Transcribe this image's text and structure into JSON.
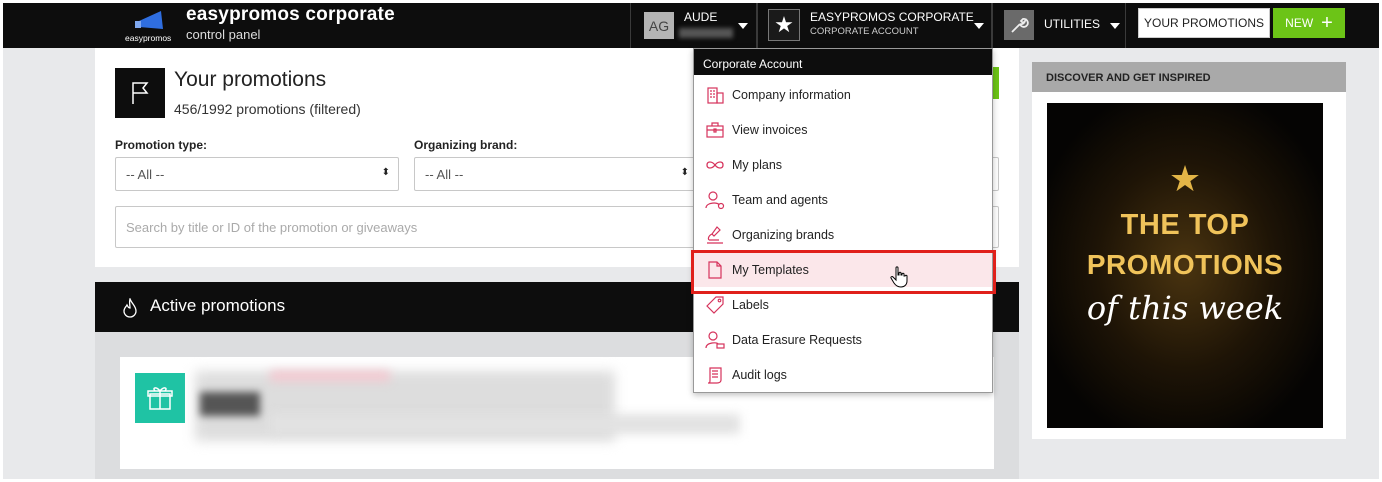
{
  "brand": {
    "name": "easypromos corporate",
    "subtitle": "control panel",
    "logo_text": "easypromos"
  },
  "topbar": {
    "user_initials": "AG",
    "user_name": "AUDE",
    "account_name": "EASYPROMOS CORPORATE",
    "account_type": "CORPORATE ACCOUNT",
    "utilities_label": "UTILITIES",
    "your_promotions_label": "YOUR PROMOTIONS",
    "new_label": "NEW",
    "new_plus": "+"
  },
  "panel": {
    "title": "Your promotions",
    "count": "456/1992 promotions (filtered)",
    "promotion_type_label": "Promotion type:",
    "promotion_type_value": "-- All --",
    "organizing_brand_label": "Organizing brand:",
    "organizing_brand_value": "-- All --",
    "select_arrow": "⬍",
    "search_placeholder": "Search by title or ID of the promotion or giveaways"
  },
  "active": {
    "label": "Active promotions"
  },
  "sidebar": {
    "heading": "DISCOVER AND GET INSPIRED",
    "banner_star": "★",
    "banner_line1": "THE TOP",
    "banner_line2": "PROMOTIONS",
    "banner_line3": "of this week"
  },
  "dropdown": {
    "heading": "Corporate Account",
    "items": [
      {
        "label": "Company information",
        "icon": "building-icon"
      },
      {
        "label": "View invoices",
        "icon": "briefcase-icon"
      },
      {
        "label": "My plans",
        "icon": "infinity-icon"
      },
      {
        "label": "Team and agents",
        "icon": "user-gear-icon"
      },
      {
        "label": "Organizing brands",
        "icon": "stamp-icon"
      },
      {
        "label": "My Templates",
        "icon": "document-icon"
      },
      {
        "label": "Labels",
        "icon": "tag-icon"
      },
      {
        "label": "Data Erasure Requests",
        "icon": "user-erase-icon"
      },
      {
        "label": "Audit logs",
        "icon": "scroll-icon"
      }
    ],
    "highlighted_item": "My Templates"
  },
  "colors": {
    "accent_pink": "#d6335c",
    "new_green": "#6cc417",
    "highlight_red": "#e0201b",
    "gift_teal": "#1fc3a4"
  }
}
